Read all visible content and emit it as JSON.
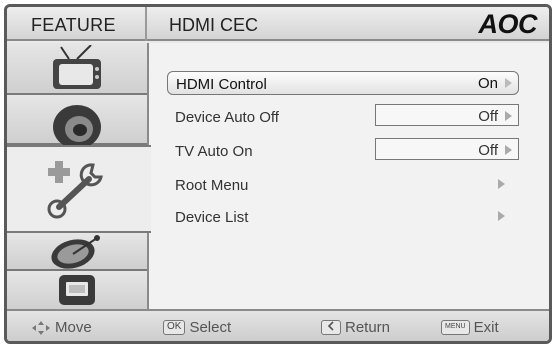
{
  "header": {
    "feature_label": "FEATURE",
    "page_title": "HDMI CEC",
    "logo": "AOC"
  },
  "sidebar": {
    "items": [
      {
        "name": "tv-icon"
      },
      {
        "name": "speaker-icon"
      },
      {
        "name": "tools-icon",
        "active": true
      },
      {
        "name": "satellite-icon"
      },
      {
        "name": "screen-icon"
      }
    ]
  },
  "menu": {
    "items": [
      {
        "label": "HDMI Control",
        "value": "On",
        "selected": true
      },
      {
        "label": "Device Auto Off",
        "value": "Off"
      },
      {
        "label": "TV Auto On",
        "value": "Off"
      },
      {
        "label": "Root Menu",
        "value": ""
      },
      {
        "label": "Device List",
        "value": ""
      }
    ]
  },
  "footer": {
    "move_label": "Move",
    "select_key": "OK",
    "select_label": "Select",
    "return_label": "Return",
    "exit_key": "MENU",
    "exit_label": "Exit"
  },
  "colors": {
    "frame": "#5a5a5a",
    "panel": "#f2f2f2",
    "arrow": "#aaaaaa"
  }
}
